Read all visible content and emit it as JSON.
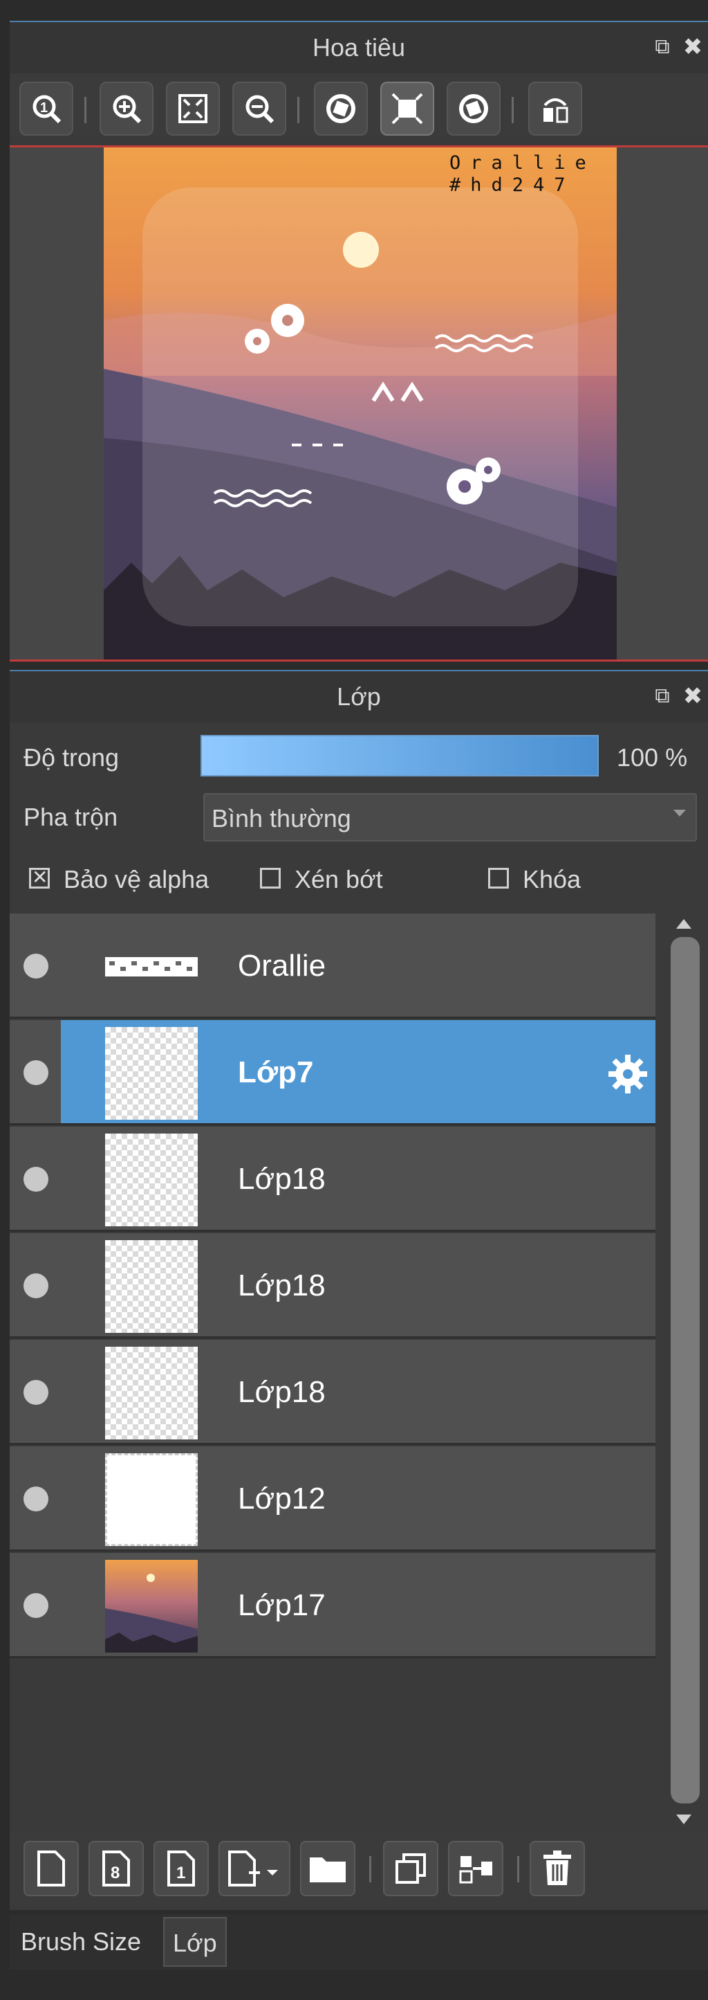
{
  "navigator": {
    "title": "Hoa tiêu",
    "canvas_text": {
      "line1": "Orallie",
      "line2": "#hd247"
    }
  },
  "layers_panel": {
    "title": "Lớp",
    "opacity_label": "Độ trong",
    "opacity_value": "100 %",
    "blend_label": "Pha trộn",
    "blend_value": "Bình thường",
    "options": [
      {
        "label": "Bảo vệ alpha",
        "checked": true
      },
      {
        "label": "Xén bớt",
        "checked": false
      },
      {
        "label": "Khóa",
        "checked": false
      }
    ],
    "layers": [
      {
        "name": "Orallie",
        "thumb": "text",
        "selected": false
      },
      {
        "name": "Lớp7",
        "thumb": "transparent",
        "selected": true
      },
      {
        "name": "Lớp18",
        "thumb": "transparent",
        "selected": false
      },
      {
        "name": "Lớp18",
        "thumb": "transparent",
        "selected": false
      },
      {
        "name": "Lớp18",
        "thumb": "transparent",
        "selected": false
      },
      {
        "name": "Lớp12",
        "thumb": "white",
        "selected": false
      },
      {
        "name": "Lớp17",
        "thumb": "sunset",
        "selected": false
      }
    ]
  },
  "bottom_tabs": [
    "Brush Size",
    "Lớp"
  ],
  "colors": {
    "accent": "#4f98d3",
    "selection_row": "#4f98d3",
    "panel_border_red": "#c23b3b"
  }
}
